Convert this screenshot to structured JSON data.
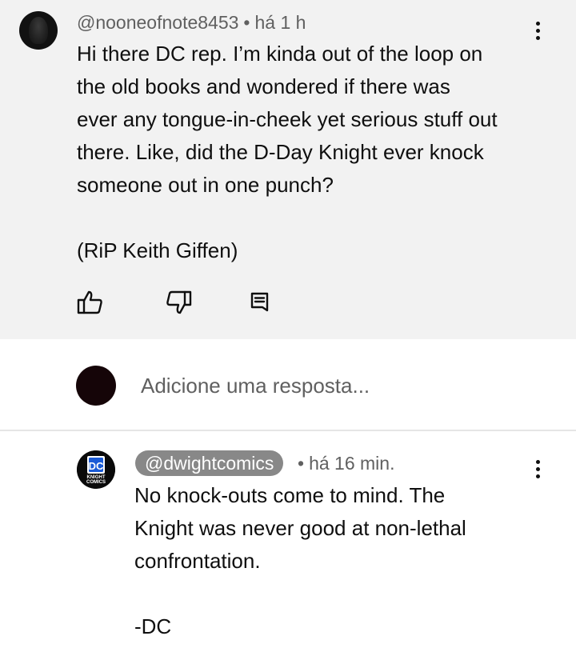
{
  "original_comment": {
    "handle": "@nooneofnote8453",
    "time": "há 1 h",
    "separator": "•",
    "lines": [
      "Hi there DC rep. I’m kinda out of the loop on",
      "the old books and wondered if there was",
      "ever any tongue-in-cheek yet serious stuff out",
      "there. Like, did the D-Day Knight ever knock",
      "someone out in one punch?"
    ],
    "footer_line": "(RiP Keith Giffen)",
    "actions": {
      "like_icon": "thumbs-up-icon",
      "dislike_icon": "thumbs-down-icon",
      "reply_icon": "comment-reply-icon"
    }
  },
  "reply_box": {
    "placeholder": "Adicione uma resposta..."
  },
  "reply_comment": {
    "handle": "@dwightcomics",
    "time": "há 16 min.",
    "separator": "•",
    "logo_text": {
      "top": "DC",
      "bottom_1": "KNIGHT",
      "bottom_2": "COMICS"
    },
    "lines": [
      "No knock-outs come to mind. The",
      "Knight was never good at non-lethal",
      "confrontation."
    ],
    "signature": "-DC"
  },
  "colors": {
    "top_comment_bg": "#f2f2f2",
    "meta_text": "#606060",
    "author_badge_bg": "#888888",
    "dc_blue": "#1a5bd6"
  }
}
